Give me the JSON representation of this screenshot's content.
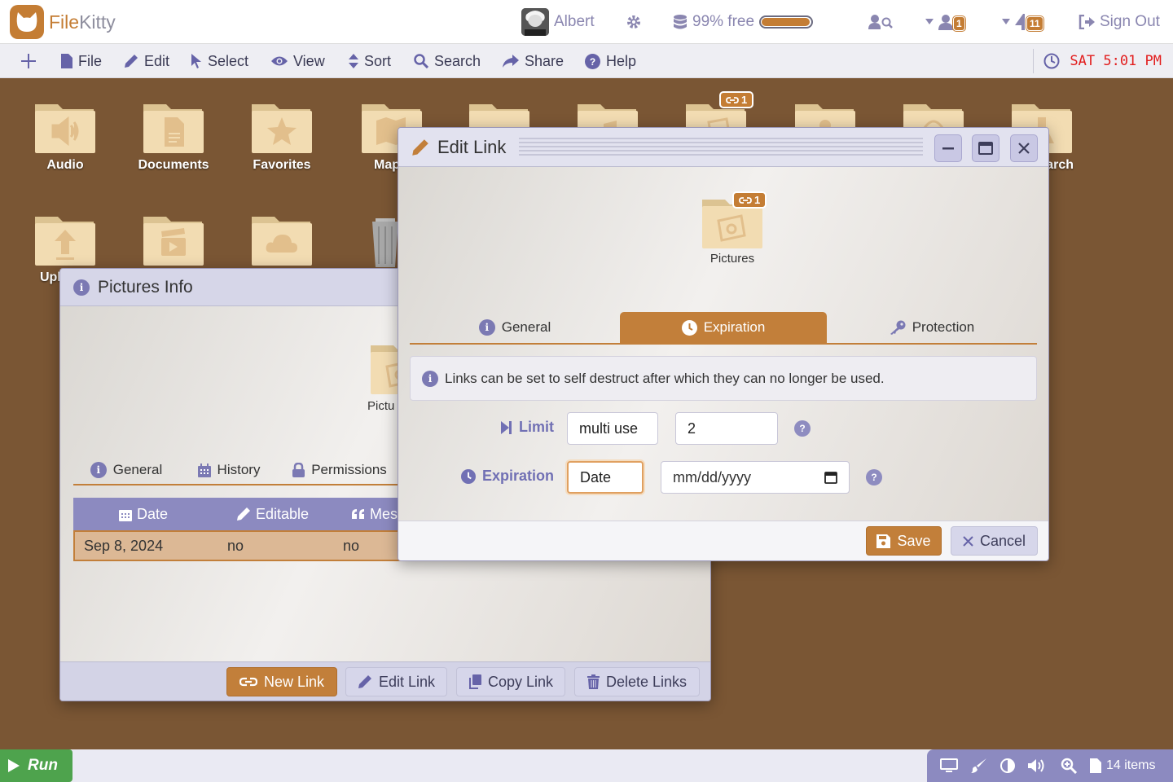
{
  "app": {
    "name_part1": "File",
    "name_part2": "Kitty"
  },
  "topbar": {
    "user": "Albert",
    "storage_text": "99% free",
    "storage_used_fraction": 0.99,
    "groups_badge": "1",
    "notifications_badge": "11",
    "signout_label": "Sign Out"
  },
  "menubar": {
    "items": [
      "File",
      "Edit",
      "Select",
      "View",
      "Sort",
      "Search",
      "Share",
      "Help"
    ],
    "clock": "SAT 5:01 PM"
  },
  "desktop": {
    "icons": [
      "Audio",
      "Documents",
      "Favorites",
      "Map",
      "",
      "",
      "",
      "",
      "",
      "Research",
      "Upl"
    ],
    "pictures_link_count": "1"
  },
  "info_window": {
    "title": "Pictures Info",
    "folder_label": "Pictu",
    "tabs": [
      "General",
      "History",
      "Permissions"
    ],
    "table": {
      "headers": [
        "Date",
        "Editable",
        "Mes"
      ],
      "rows": [
        [
          "Sep 8, 2024",
          "no",
          "no"
        ]
      ]
    },
    "buttons": {
      "new_link": "New Link",
      "edit_link": "Edit Link",
      "copy_link": "Copy Link",
      "delete_links": "Delete Links"
    }
  },
  "edit_window": {
    "title": "Edit Link",
    "folder_label": "Pictures",
    "link_count": "1",
    "tabs": [
      "General",
      "Expiration",
      "Protection"
    ],
    "active_tab": "Expiration",
    "notice": "Links can be set to self destruct after which they can no longer be used.",
    "limit_label": "Limit",
    "limit_mode": "multi use",
    "limit_value": "2",
    "expiration_label": "Expiration",
    "expiration_mode": "Date",
    "date_placeholder": "mm/dd/yyyy",
    "save_label": "Save",
    "cancel_label": "Cancel"
  },
  "dock": {
    "run_label": "Run",
    "items_count": "14 items"
  },
  "colors": {
    "accent": "#c27f3a",
    "desktop": "#7a5634",
    "menu_icon": "#6663a8",
    "clock": "#e21d1d"
  }
}
